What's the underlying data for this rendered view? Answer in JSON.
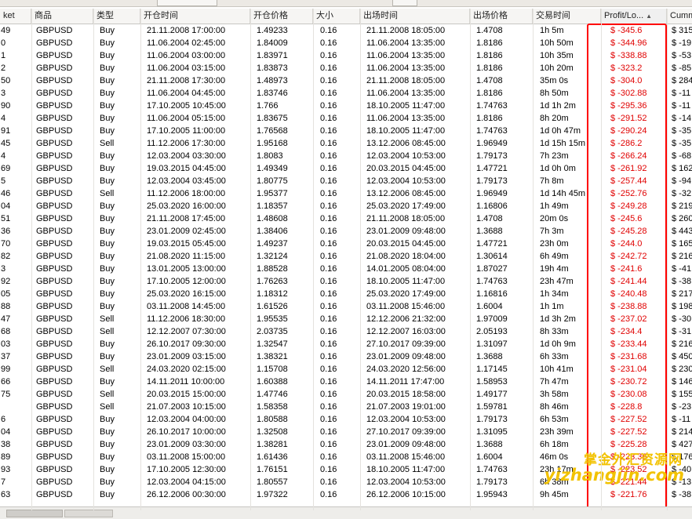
{
  "columns": [
    "ket",
    "商品",
    "类型",
    "开仓时间",
    "开仓价格",
    "大小",
    "出场时间",
    "出场价格",
    "交易时间",
    "Profit/Lo...",
    "Cumm"
  ],
  "sorted_column_index": 9,
  "rows": [
    [
      "49",
      "GBPUSD",
      "Buy",
      "21.11.2008 17:00:00",
      "1.49233",
      "0.16",
      "21.11.2008 18:05:00",
      "1.4708",
      "1h 5m",
      "$ -345.6",
      "$ 315"
    ],
    [
      "0",
      "GBPUSD",
      "Buy",
      "11.06.2004 02:45:00",
      "1.84009",
      "0.16",
      "11.06.2004 13:35:00",
      "1.8186",
      "10h 50m",
      "$ -344.96",
      "$ -19"
    ],
    [
      "1",
      "GBPUSD",
      "Buy",
      "11.06.2004 03:00:00",
      "1.83971",
      "0.16",
      "11.06.2004 13:35:00",
      "1.8186",
      "10h 35m",
      "$ -338.88",
      "$ -53"
    ],
    [
      "2",
      "GBPUSD",
      "Buy",
      "11.06.2004 03:15:00",
      "1.83873",
      "0.16",
      "11.06.2004 13:35:00",
      "1.8186",
      "10h 20m",
      "$ -323.2",
      "$ -85"
    ],
    [
      "50",
      "GBPUSD",
      "Buy",
      "21.11.2008 17:30:00",
      "1.48973",
      "0.16",
      "21.11.2008 18:05:00",
      "1.4708",
      "35m 0s",
      "$ -304.0",
      "$ 284"
    ],
    [
      "3",
      "GBPUSD",
      "Buy",
      "11.06.2004 04:45:00",
      "1.83746",
      "0.16",
      "11.06.2004 13:35:00",
      "1.8186",
      "8h 50m",
      "$ -302.88",
      "$ -11"
    ],
    [
      "90",
      "GBPUSD",
      "Buy",
      "17.10.2005 10:45:00",
      "1.766",
      "0.16",
      "18.10.2005 11:47:00",
      "1.74763",
      "1d 1h 2m",
      "$ -295.36",
      "$ -11"
    ],
    [
      "4",
      "GBPUSD",
      "Buy",
      "11.06.2004 05:15:00",
      "1.83675",
      "0.16",
      "11.06.2004 13:35:00",
      "1.8186",
      "8h 20m",
      "$ -291.52",
      "$ -14"
    ],
    [
      "91",
      "GBPUSD",
      "Buy",
      "17.10.2005 11:00:00",
      "1.76568",
      "0.16",
      "18.10.2005 11:47:00",
      "1.74763",
      "1d 0h 47m",
      "$ -290.24",
      "$ -35"
    ],
    [
      "45",
      "GBPUSD",
      "Sell",
      "11.12.2006 17:30:00",
      "1.95168",
      "0.16",
      "13.12.2006 08:45:00",
      "1.96949",
      "1d 15h 15m",
      "$ -286.2",
      "$ -35"
    ],
    [
      "4",
      "GBPUSD",
      "Buy",
      "12.03.2004 03:30:00",
      "1.8083",
      "0.16",
      "12.03.2004 10:53:00",
      "1.79173",
      "7h 23m",
      "$ -266.24",
      "$ -68"
    ],
    [
      "69",
      "GBPUSD",
      "Buy",
      "19.03.2015 04:45:00",
      "1.49349",
      "0.16",
      "20.03.2015 04:45:00",
      "1.47721",
      "1d 0h 0m",
      "$ -261.92",
      "$ 162"
    ],
    [
      "5",
      "GBPUSD",
      "Buy",
      "12.03.2004 03:45:00",
      "1.80775",
      "0.16",
      "12.03.2004 10:53:00",
      "1.79173",
      "7h 8m",
      "$ -257.44",
      "$ -94"
    ],
    [
      "46",
      "GBPUSD",
      "Sell",
      "11.12.2006 18:00:00",
      "1.95377",
      "0.16",
      "13.12.2006 08:45:00",
      "1.96949",
      "1d 14h 45m",
      "$ -252.76",
      "$ -32"
    ],
    [
      "04",
      "GBPUSD",
      "Buy",
      "25.03.2020 16:00:00",
      "1.18357",
      "0.16",
      "25.03.2020 17:49:00",
      "1.16806",
      "1h 49m",
      "$ -249.28",
      "$ 219"
    ],
    [
      "51",
      "GBPUSD",
      "Buy",
      "21.11.2008 17:45:00",
      "1.48608",
      "0.16",
      "21.11.2008 18:05:00",
      "1.4708",
      "20m 0s",
      "$ -245.6",
      "$ 260"
    ],
    [
      "36",
      "GBPUSD",
      "Buy",
      "23.01.2009 02:45:00",
      "1.38406",
      "0.16",
      "23.01.2009 09:48:00",
      "1.3688",
      "7h 3m",
      "$ -245.28",
      "$ 443"
    ],
    [
      "70",
      "GBPUSD",
      "Buy",
      "19.03.2015 05:45:00",
      "1.49237",
      "0.16",
      "20.03.2015 04:45:00",
      "1.47721",
      "23h 0m",
      "$ -244.0",
      "$ 165"
    ],
    [
      "82",
      "GBPUSD",
      "Buy",
      "21.08.2020 11:15:00",
      "1.32124",
      "0.16",
      "21.08.2020 18:04:00",
      "1.30614",
      "6h 49m",
      "$ -242.72",
      "$ 216"
    ],
    [
      "3",
      "GBPUSD",
      "Buy",
      "13.01.2005 13:00:00",
      "1.88528",
      "0.16",
      "14.01.2005 08:04:00",
      "1.87027",
      "19h 4m",
      "$ -241.6",
      "$ -41"
    ],
    [
      "92",
      "GBPUSD",
      "Buy",
      "17.10.2005 12:00:00",
      "1.76263",
      "0.16",
      "18.10.2005 11:47:00",
      "1.74763",
      "23h 47m",
      "$ -241.44",
      "$ -38"
    ],
    [
      "05",
      "GBPUSD",
      "Buy",
      "25.03.2020 16:15:00",
      "1.18312",
      "0.16",
      "25.03.2020 17:49:00",
      "1.16816",
      "1h 34m",
      "$ -240.48",
      "$ 217"
    ],
    [
      "88",
      "GBPUSD",
      "Buy",
      "03.11.2008 14:45:00",
      "1.61526",
      "0.16",
      "03.11.2008 15:46:00",
      "1.6004",
      "1h 1m",
      "$ -238.88",
      "$ 198"
    ],
    [
      "47",
      "GBPUSD",
      "Sell",
      "11.12.2006 18:30:00",
      "1.95535",
      "0.16",
      "12.12.2006 21:32:00",
      "1.97009",
      "1d 3h 2m",
      "$ -237.02",
      "$ -30"
    ],
    [
      "68",
      "GBPUSD",
      "Sell",
      "12.12.2007 07:30:00",
      "2.03735",
      "0.16",
      "12.12.2007 16:03:00",
      "2.05193",
      "8h 33m",
      "$ -234.4",
      "$ -31"
    ],
    [
      "03",
      "GBPUSD",
      "Buy",
      "26.10.2017 09:30:00",
      "1.32547",
      "0.16",
      "27.10.2017 09:39:00",
      "1.31097",
      "1d 0h 9m",
      "$ -233.44",
      "$ 216"
    ],
    [
      "37",
      "GBPUSD",
      "Buy",
      "23.01.2009 03:15:00",
      "1.38321",
      "0.16",
      "23.01.2009 09:48:00",
      "1.3688",
      "6h 33m",
      "$ -231.68",
      "$ 450"
    ],
    [
      "99",
      "GBPUSD",
      "Sell",
      "24.03.2020 02:15:00",
      "1.15708",
      "0.16",
      "24.03.2020 12:56:00",
      "1.17145",
      "10h 41m",
      "$ -231.04",
      "$ 230"
    ],
    [
      "66",
      "GBPUSD",
      "Buy",
      "14.11.2011 10:00:00",
      "1.60388",
      "0.16",
      "14.11.2011 17:47:00",
      "1.58953",
      "7h 47m",
      "$ -230.72",
      "$ 146"
    ],
    [
      "75",
      "GBPUSD",
      "Sell",
      "20.03.2015 15:00:00",
      "1.47746",
      "0.16",
      "20.03.2015 18:58:00",
      "1.49177",
      "3h 58m",
      "$ -230.08",
      "$ 155"
    ],
    [
      "",
      "GBPUSD",
      "Sell",
      "21.07.2003 10:15:00",
      "1.58358",
      "0.16",
      "21.07.2003 19:01:00",
      "1.59781",
      "8h 46m",
      "$ -228.8",
      "$ -23"
    ],
    [
      "6",
      "GBPUSD",
      "Buy",
      "12.03.2004 04:00:00",
      "1.80588",
      "0.16",
      "12.03.2004 10:53:00",
      "1.79173",
      "6h 53m",
      "$ -227.52",
      "$ -11"
    ],
    [
      "04",
      "GBPUSD",
      "Buy",
      "26.10.2017 10:00:00",
      "1.32508",
      "0.16",
      "27.10.2017 09:39:00",
      "1.31095",
      "23h 39m",
      "$ -227.52",
      "$ 214"
    ],
    [
      "38",
      "GBPUSD",
      "Buy",
      "23.01.2009 03:30:00",
      "1.38281",
      "0.16",
      "23.01.2009 09:48:00",
      "1.3688",
      "6h 18m",
      "$ -225.28",
      "$ 427"
    ],
    [
      "89",
      "GBPUSD",
      "Buy",
      "03.11.2008 15:00:00",
      "1.61436",
      "0.16",
      "03.11.2008 15:46:00",
      "1.6004",
      "46m 0s",
      "$ -223.36",
      "$ 176"
    ],
    [
      "93",
      "GBPUSD",
      "Buy",
      "17.10.2005 12:30:00",
      "1.76151",
      "0.16",
      "18.10.2005 11:47:00",
      "1.74763",
      "23h 17m",
      "$ -223.52",
      "$ -40"
    ],
    [
      "7",
      "GBPUSD",
      "Buy",
      "12.03.2004 04:15:00",
      "1.80557",
      "0.16",
      "12.03.2004 10:53:00",
      "1.79173",
      "6h 38m",
      "$ -221.44",
      "$ -13"
    ],
    [
      "63",
      "GBPUSD",
      "Buy",
      "26.12.2006 00:30:00",
      "1.97322",
      "0.16",
      "26.12.2006 10:15:00",
      "1.95943",
      "9h 45m",
      "$ -221.76",
      "$ -38"
    ]
  ],
  "watermark": {
    "chinese": "掌金外汇资源网",
    "url": "yizhangjin.com"
  }
}
